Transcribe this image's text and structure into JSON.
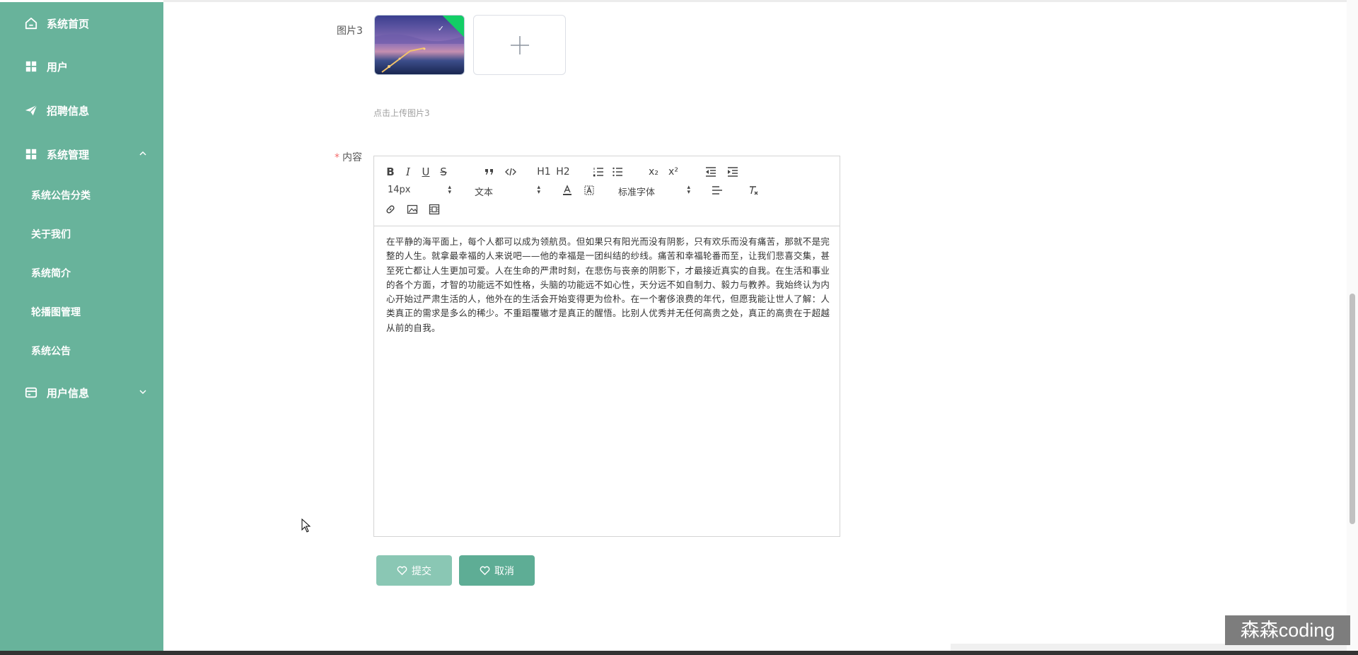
{
  "sidebar": {
    "items": [
      {
        "label": "系统首页",
        "icon": "home-icon"
      },
      {
        "label": "用户",
        "icon": "grid-icon"
      },
      {
        "label": "招聘信息",
        "icon": "paper-plane-icon"
      },
      {
        "label": "系统管理",
        "icon": "grid-icon",
        "expanded": true
      },
      {
        "label": "用户信息",
        "icon": "card-icon",
        "expanded": false
      }
    ],
    "submenu": [
      {
        "label": "系统公告分类"
      },
      {
        "label": "关于我们"
      },
      {
        "label": "系统简介"
      },
      {
        "label": "轮播图管理"
      },
      {
        "label": "系统公告"
      }
    ]
  },
  "form": {
    "image3": {
      "label": "图片3",
      "tip": "点击上传图片3"
    },
    "content": {
      "label": "内容",
      "required_mark": "*",
      "text": "在平静的海平面上，每个人都可以成为领航员。但如果只有阳光而没有阴影，只有欢乐而没有痛苦，那就不是完整的人生。就拿最幸福的人来说吧——他的幸福是一团纠结的纱线。痛苦和幸福轮番而至，让我们悲喜交集，甚至死亡都让人生更加可爱。人在生命的严肃时刻，在悲伤与丧亲的阴影下，才最接近真实的自我。在生活和事业的各个方面，才智的功能远不如性格，头脑的功能远不如心性，天分远不如自制力、毅力与教养。我始终认为内心开始过严肃生活的人，他外在的生活会开始变得更为俭朴。在一个奢侈浪费的年代，但愿我能让世人了解：人类真正的需求是多么的稀少。不重蹈覆辙才是真正的醒悟。比别人优秀并无任何高贵之处，真正的高贵在于超越从前的自我。"
    },
    "editor": {
      "font_size": "14px",
      "header_select": "文本",
      "font_family": "标准字体",
      "tools_row1": [
        "B",
        "I",
        "U",
        "S"
      ],
      "sub_label": "x₂",
      "sup_label": "x²",
      "h1": "H1",
      "h2": "H2"
    },
    "buttons": {
      "submit": "提交",
      "cancel": "取消"
    }
  },
  "watermark": "森森coding",
  "colors": {
    "sidebar": "#68b39b",
    "submit": "#8ac7b4",
    "cancel": "#5ead95",
    "success": "#13ce66"
  }
}
